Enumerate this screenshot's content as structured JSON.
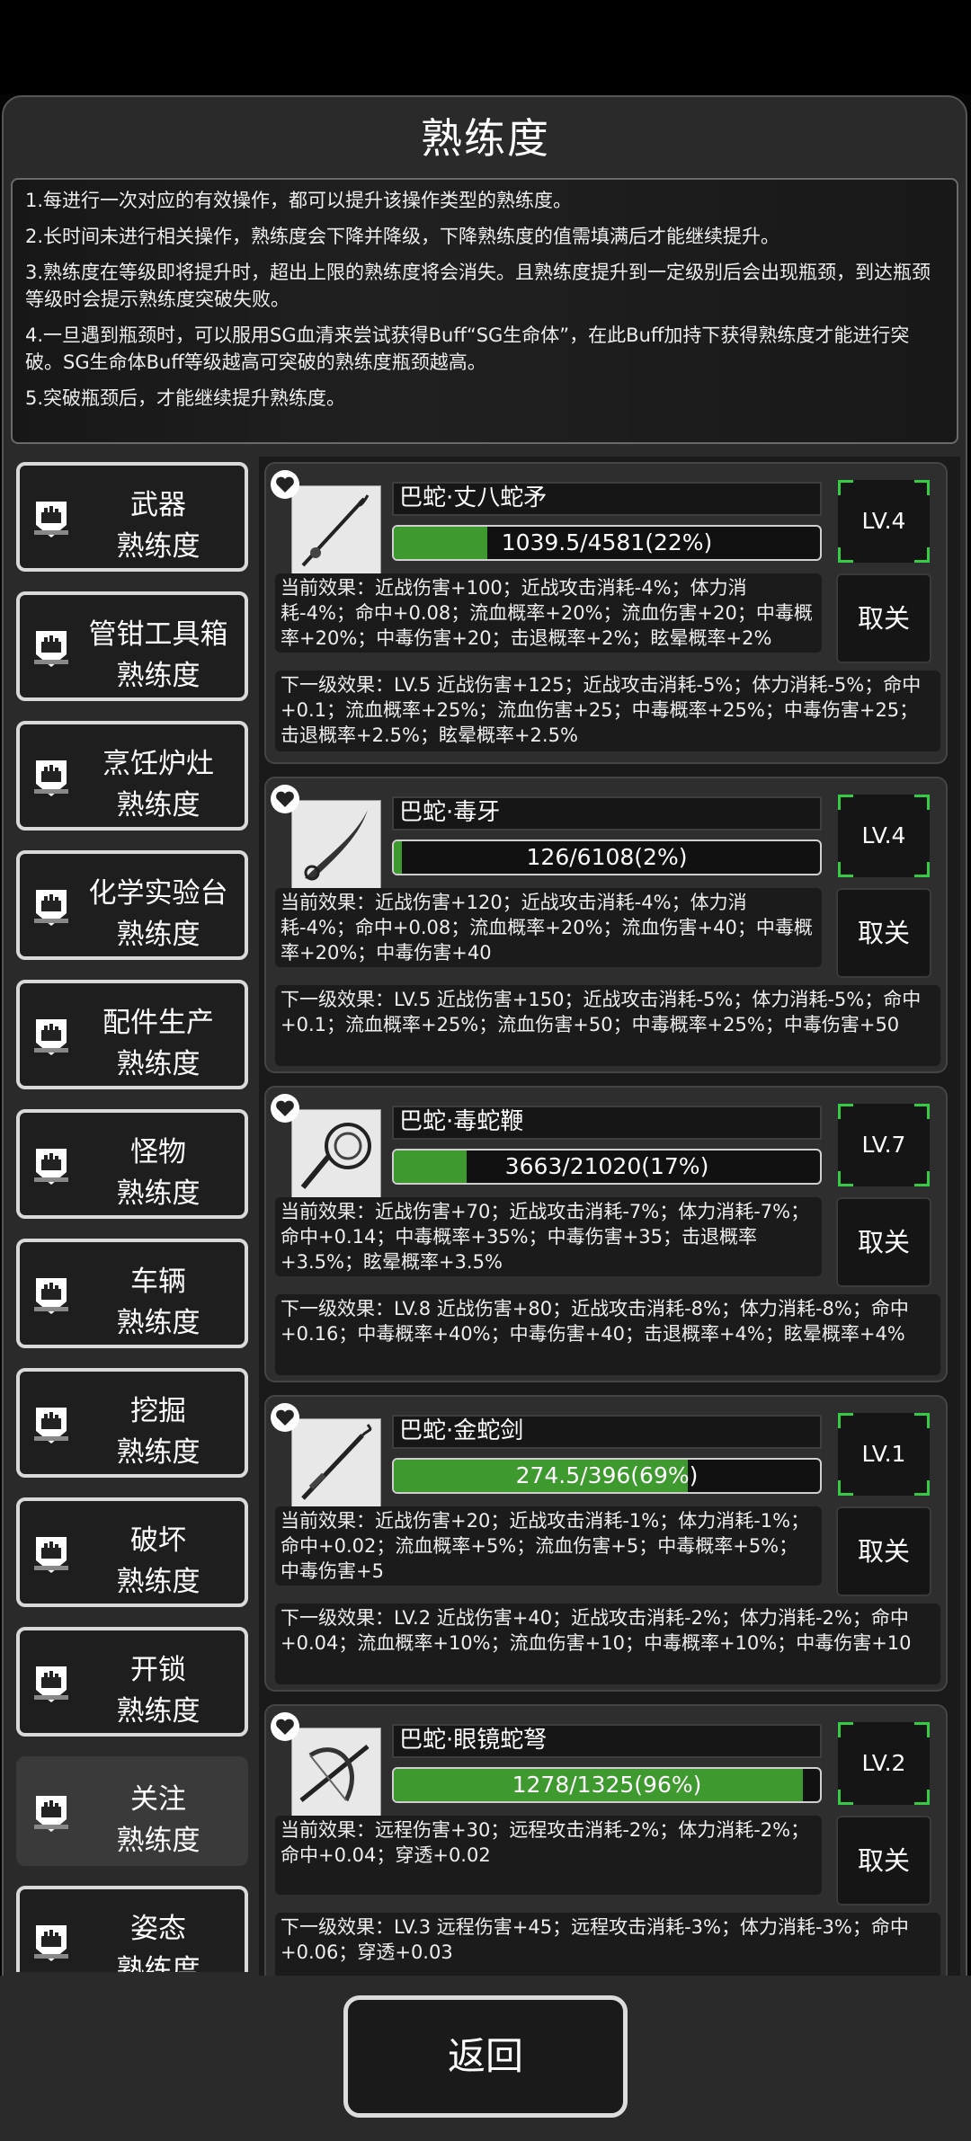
{
  "page": {
    "title": "熟练度"
  },
  "description": [
    "1.每进行一次对应的有效操作，都可以提升该操作类型的熟练度。",
    "2.长时间未进行相关操作，熟练度会下降并降级，下降熟练度的值需填满后才能继续提升。",
    "3.熟练度在等级即将提升时，超出上限的熟练度将会消失。且熟练度提升到一定级别后会出现瓶颈，到达瓶颈等级时会提示熟练度突破失败。",
    "4.一旦遇到瓶颈时，可以服用SG血清来尝试获得Buff“SG生命体”，在此Buff加持下获得熟练度才能进行突破。SG生命体Buff等级越高可突破的熟练度瓶颈越高。",
    "5.突破瓶颈后，才能继续提升熟练度。"
  ],
  "sidebar": {
    "items": [
      {
        "line1": "武器",
        "line2": "熟练度"
      },
      {
        "line1": "管钳工具箱",
        "line2": "熟练度"
      },
      {
        "line1": "烹饪炉灶",
        "line2": "熟练度"
      },
      {
        "line1": "化学实验台",
        "line2": "熟练度"
      },
      {
        "line1": "配件生产",
        "line2": "熟练度"
      },
      {
        "line1": "怪物",
        "line2": "熟练度"
      },
      {
        "line1": "车辆",
        "line2": "熟练度"
      },
      {
        "line1": "挖掘",
        "line2": "熟练度"
      },
      {
        "line1": "破坏",
        "line2": "熟练度"
      },
      {
        "line1": "开锁",
        "line2": "熟练度"
      },
      {
        "line1": "关注",
        "line2": "熟练度"
      },
      {
        "line1": "姿态",
        "line2": "熟练度"
      }
    ],
    "active_index": 10
  },
  "cards": [
    {
      "name": "巴蛇·丈八蛇矛",
      "progress_text": "1039.5/4581(22%)",
      "progress": 0.22,
      "level": "LV.4",
      "current": "当前效果：近战伤害+100；近战攻击消耗-4%；体力消耗-4%；命中+0.08；流血概率+20%；流血伤害+20；中毒概率+20%；中毒伤害+20；击退概率+2%；眩晕概率+2%",
      "next": "下一级效果：LV.5 近战伤害+125；近战攻击消耗-5%；体力消耗-5%；命中+0.1；流血概率+25%；流血伤害+25；中毒概率+25%；中毒伤害+25；击退概率+2.5%；眩晕概率+2.5%",
      "unfollow": "取关"
    },
    {
      "name": "巴蛇·毒牙",
      "progress_text": "126/6108(2%)",
      "progress": 0.02,
      "level": "LV.4",
      "current": "当前效果：近战伤害+120；近战攻击消耗-4%；体力消耗-4%；命中+0.08；流血概率+20%；流血伤害+40；中毒概率+20%；中毒伤害+40",
      "next": "下一级效果：LV.5 近战伤害+150；近战攻击消耗-5%；体力消耗-5%；命中+0.1；流血概率+25%；流血伤害+50；中毒概率+25%；中毒伤害+50",
      "unfollow": "取关"
    },
    {
      "name": "巴蛇·毒蛇鞭",
      "progress_text": "3663/21020(17%)",
      "progress": 0.17,
      "level": "LV.7",
      "current": "当前效果：近战伤害+70；近战攻击消耗-7%；体力消耗-7%；命中+0.14；中毒概率+35%；中毒伤害+35；击退概率+3.5%；眩晕概率+3.5%",
      "next": "下一级效果：LV.8 近战伤害+80；近战攻击消耗-8%；体力消耗-8%；命中+0.16；中毒概率+40%；中毒伤害+40；击退概率+4%；眩晕概率+4%",
      "unfollow": "取关"
    },
    {
      "name": "巴蛇·金蛇剑",
      "progress_text": "274.5/396(69%)",
      "progress": 0.69,
      "level": "LV.1",
      "current": "当前效果：近战伤害+20；近战攻击消耗-1%；体力消耗-1%；命中+0.02；流血概率+5%；流血伤害+5；中毒概率+5%；中毒伤害+5",
      "next": "下一级效果：LV.2 近战伤害+40；近战攻击消耗-2%；体力消耗-2%；命中+0.04；流血概率+10%；流血伤害+10；中毒概率+10%；中毒伤害+10",
      "unfollow": "取关"
    },
    {
      "name": "巴蛇·眼镜蛇弩",
      "progress_text": "1278/1325(96%)",
      "progress": 0.96,
      "level": "LV.2",
      "current": "当前效果：远程伤害+30；远程攻击消耗-2%；体力消耗-2%；命中+0.04；穿透+0.02",
      "next": "下一级效果：LV.3 远程伤害+45；远程攻击消耗-3%；体力消耗-3%；命中+0.06；穿透+0.03",
      "unfollow": "取关"
    }
  ],
  "footer": {
    "back_label": "返回"
  }
}
